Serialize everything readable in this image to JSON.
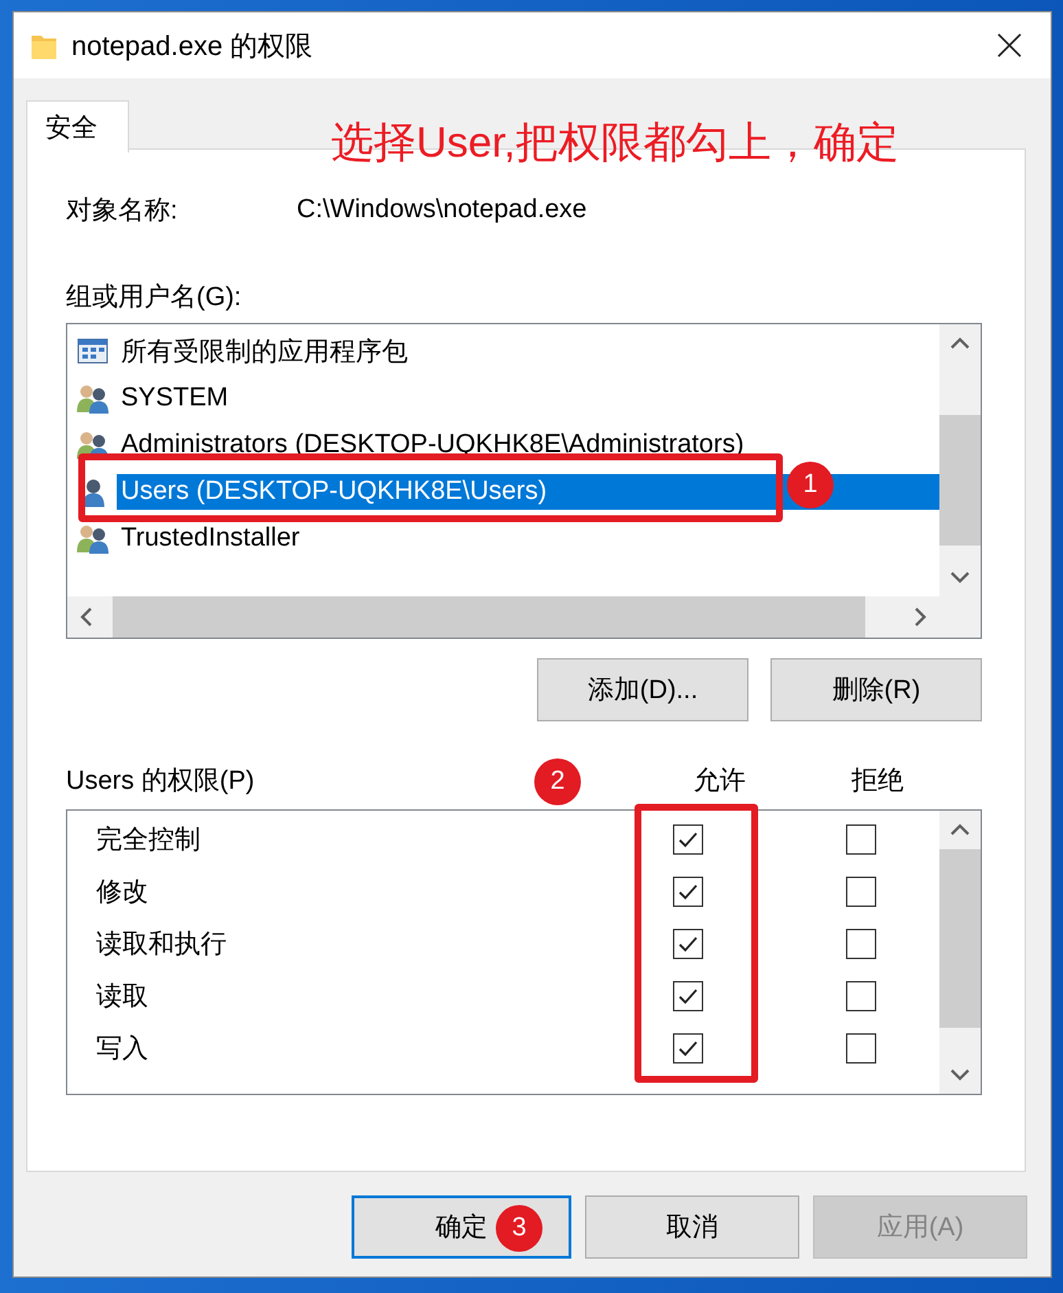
{
  "window": {
    "title": "notepad.exe 的权限"
  },
  "tabs": [
    {
      "label": "安全",
      "selected": true
    }
  ],
  "annotation": {
    "text": "选择User,把权限都勾上，确定"
  },
  "object_name": {
    "label": "对象名称:",
    "value": "C:\\Windows\\notepad.exe"
  },
  "principals": {
    "label": "组或用户名(G):",
    "items": [
      {
        "name": "所有受限制的应用程序包",
        "kind": "package",
        "selected": false
      },
      {
        "name": "SYSTEM",
        "kind": "group",
        "selected": false
      },
      {
        "name": "Administrators (DESKTOP-UQKHK8E\\Administrators)",
        "kind": "group",
        "selected": false
      },
      {
        "name": "Users (DESKTOP-UQKHK8E\\Users)",
        "kind": "user",
        "selected": true
      },
      {
        "name": "TrustedInstaller",
        "kind": "group",
        "selected": false
      }
    ]
  },
  "principal_buttons": [
    "添加(D)...",
    "删除(R)"
  ],
  "permissions": {
    "label": "Users 的权限(P)",
    "columns": [
      "允许",
      "拒绝"
    ],
    "rows": [
      {
        "name": "完全控制",
        "allow": true,
        "deny": false
      },
      {
        "name": "修改",
        "allow": true,
        "deny": false
      },
      {
        "name": "读取和执行",
        "allow": true,
        "deny": false
      },
      {
        "name": "读取",
        "allow": true,
        "deny": false
      },
      {
        "name": "写入",
        "allow": true,
        "deny": false
      }
    ]
  },
  "callouts": [
    "1",
    "2",
    "3"
  ],
  "buttons": [
    {
      "label": "确定",
      "kind": "default",
      "disabled": false
    },
    {
      "label": "取消",
      "kind": "normal",
      "disabled": false
    },
    {
      "label": "应用(A)",
      "kind": "normal",
      "disabled": true
    }
  ]
}
